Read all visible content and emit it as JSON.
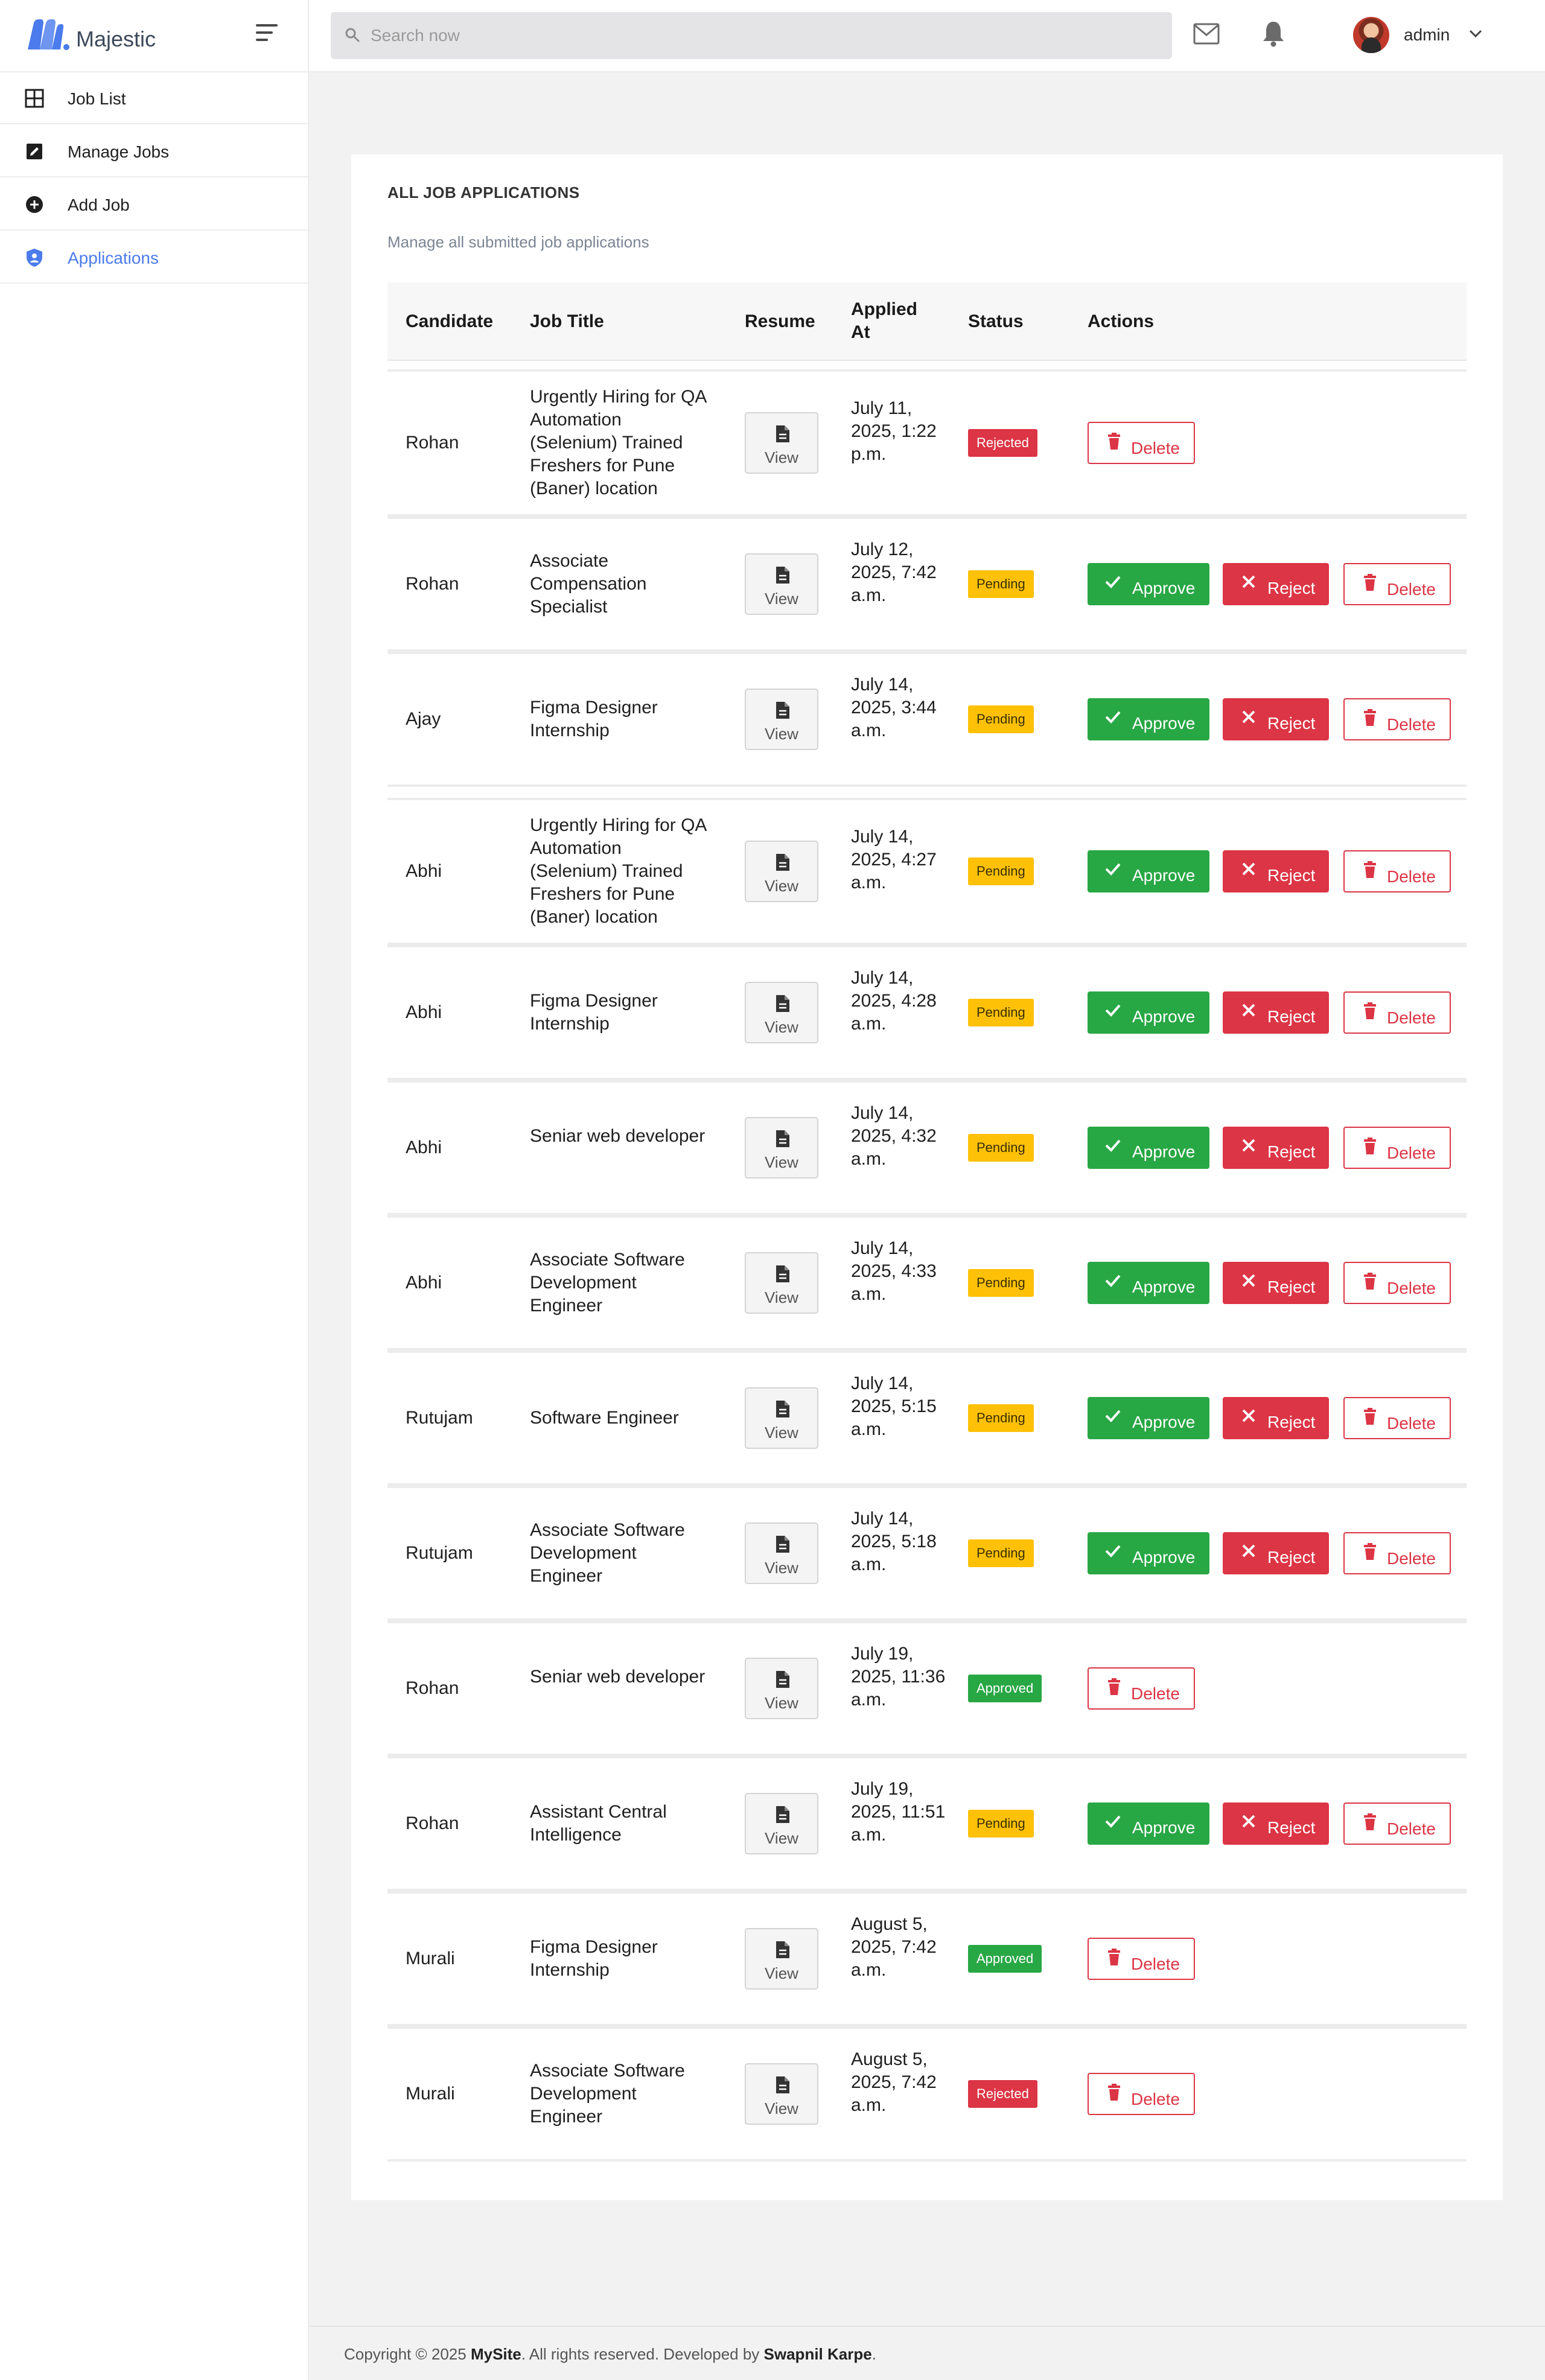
{
  "brand": {
    "name": "Majestic"
  },
  "search": {
    "placeholder": "Search now"
  },
  "user": {
    "name": "admin"
  },
  "sidebar": {
    "items": [
      {
        "label": "Job List",
        "icon": "grid-icon",
        "active": false
      },
      {
        "label": "Manage Jobs",
        "icon": "edit-icon",
        "active": false
      },
      {
        "label": "Add Job",
        "icon": "plus-circle-icon",
        "active": false
      },
      {
        "label": "Applications",
        "icon": "shield-user-icon",
        "active": true
      }
    ]
  },
  "page": {
    "title": "ALL JOB APPLICATIONS",
    "subtitle": "Manage all submitted job applications"
  },
  "table": {
    "headers": {
      "candidate": "Candidate",
      "job_title": "Job Title",
      "resume": "Resume",
      "applied_at": "Applied At",
      "status": "Status",
      "actions": "Actions"
    },
    "view_label": "View",
    "approve_label": "Approve",
    "reject_label": "Reject",
    "delete_label": "Delete",
    "rows": [
      {
        "candidate": "Rohan",
        "job_title": "Urgently Hiring for QA Automation (Selenium) Trained Freshers for Pune (Baner) location",
        "applied_at": "July 11, 2025, 1:22 p.m.",
        "status": "Rejected"
      },
      {
        "candidate": "Rohan",
        "job_title": "Associate Compensation Specialist",
        "applied_at": "July 12, 2025, 7:42 a.m.",
        "status": "Pending"
      },
      {
        "candidate": "Ajay",
        "job_title": "Figma Designer Internship",
        "applied_at": "July 14, 2025, 3:44 a.m.",
        "status": "Pending"
      },
      {
        "candidate": "Abhi",
        "job_title": "Urgently Hiring for QA Automation (Selenium) Trained Freshers for Pune (Baner) location",
        "applied_at": "July 14, 2025, 4:27 a.m.",
        "status": "Pending"
      },
      {
        "candidate": "Abhi",
        "job_title": "Figma Designer Internship",
        "applied_at": "July 14, 2025, 4:28 a.m.",
        "status": "Pending"
      },
      {
        "candidate": "Abhi",
        "job_title": "Seniar web developer",
        "applied_at": "July 14, 2025, 4:32 a.m.",
        "status": "Pending"
      },
      {
        "candidate": "Abhi",
        "job_title": "Associate Software Development Engineer",
        "applied_at": "July 14, 2025, 4:33 a.m.",
        "status": "Pending"
      },
      {
        "candidate": "Rutujam",
        "job_title": "Software Engineer",
        "applied_at": "July 14, 2025, 5:15 a.m.",
        "status": "Pending"
      },
      {
        "candidate": "Rutujam",
        "job_title": "Associate Software Development Engineer",
        "applied_at": "July 14, 2025, 5:18 a.m.",
        "status": "Pending"
      },
      {
        "candidate": "Rohan",
        "job_title": "Seniar web developer",
        "applied_at": "July 19, 2025, 11:36 a.m.",
        "status": "Approved"
      },
      {
        "candidate": "Rohan",
        "job_title": "Assistant Central Intelligence",
        "applied_at": "July 19, 2025, 11:51 a.m.",
        "status": "Pending"
      },
      {
        "candidate": "Murali",
        "job_title": "Figma Designer Internship",
        "applied_at": "August 5, 2025, 7:42 a.m.",
        "status": "Approved"
      },
      {
        "candidate": "Murali",
        "job_title": "Associate Software Development Engineer",
        "applied_at": "August 5, 2025, 7:42 a.m.",
        "status": "Rejected"
      }
    ]
  },
  "footer": {
    "prefix": "Copyright © 2025 ",
    "site": "MySite",
    "middle": ". All rights reserved. Developed by ",
    "author": "Swapnil Karpe",
    "suffix": "."
  },
  "colors": {
    "accent": "#4b7bec",
    "approve": "#28a745",
    "reject": "#dc3545",
    "pending": "#ffc107"
  }
}
